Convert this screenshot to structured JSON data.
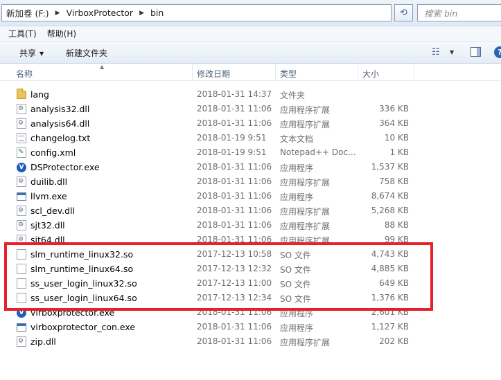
{
  "address_bar": {
    "crumbs": [
      "新加卷 (F:)",
      "VirboxProtector",
      "bin"
    ],
    "search_placeholder": "搜索 bin"
  },
  "menu": {
    "items": [
      "工具(T)",
      "帮助(H)"
    ]
  },
  "toolbar": {
    "share_label": "共享",
    "new_folder_label": "新建文件夹"
  },
  "columns": {
    "name": "名称",
    "date": "修改日期",
    "type": "类型",
    "size": "大小"
  },
  "files": [
    {
      "name": "lang",
      "date": "2018-01-31 14:37",
      "type": "文件夹",
      "size": "",
      "icon": "folder-icon"
    },
    {
      "name": "analysis32.dll",
      "date": "2018-01-31 11:06",
      "type": "应用程序扩展",
      "size": "336 KB",
      "icon": "dll-icon"
    },
    {
      "name": "analysis64.dll",
      "date": "2018-01-31 11:06",
      "type": "应用程序扩展",
      "size": "364 KB",
      "icon": "dll-icon"
    },
    {
      "name": "changelog.txt",
      "date": "2018-01-19 9:51",
      "type": "文本文档",
      "size": "10 KB",
      "icon": "txt-icon"
    },
    {
      "name": "config.xml",
      "date": "2018-01-19 9:51",
      "type": "Notepad++ Doc...",
      "size": "1 KB",
      "icon": "xml-icon"
    },
    {
      "name": "DSProtector.exe",
      "date": "2018-01-31 11:06",
      "type": "应用程序",
      "size": "1,537 KB",
      "icon": "virbox-exe-icon"
    },
    {
      "name": "duilib.dll",
      "date": "2018-01-31 11:06",
      "type": "应用程序扩展",
      "size": "758 KB",
      "icon": "dll-icon"
    },
    {
      "name": "llvm.exe",
      "date": "2018-01-31 11:06",
      "type": "应用程序",
      "size": "8,674 KB",
      "icon": "window-exe-icon"
    },
    {
      "name": "scl_dev.dll",
      "date": "2018-01-31 11:06",
      "type": "应用程序扩展",
      "size": "5,268 KB",
      "icon": "dll-icon"
    },
    {
      "name": "sjt32.dll",
      "date": "2018-01-31 11:06",
      "type": "应用程序扩展",
      "size": "88 KB",
      "icon": "dll-icon"
    },
    {
      "name": "sjt64.dll",
      "date": "2018-01-31 11:06",
      "type": "应用程序扩展",
      "size": "99 KB",
      "icon": "dll-icon"
    },
    {
      "name": "slm_runtime_linux32.so",
      "date": "2017-12-13 10:58",
      "type": "SO 文件",
      "size": "4,743 KB",
      "icon": "file-icon"
    },
    {
      "name": "slm_runtime_linux64.so",
      "date": "2017-12-13 12:32",
      "type": "SO 文件",
      "size": "4,885 KB",
      "icon": "file-icon"
    },
    {
      "name": "ss_user_login_linux32.so",
      "date": "2017-12-13 11:00",
      "type": "SO 文件",
      "size": "649 KB",
      "icon": "file-icon"
    },
    {
      "name": "ss_user_login_linux64.so",
      "date": "2017-12-13 12:34",
      "type": "SO 文件",
      "size": "1,376 KB",
      "icon": "file-icon"
    },
    {
      "name": "virboxprotector.exe",
      "date": "2018-01-31 11:06",
      "type": "应用程序",
      "size": "2,601 KB",
      "icon": "virbox-exe-icon"
    },
    {
      "name": "virboxprotector_con.exe",
      "date": "2018-01-31 11:06",
      "type": "应用程序",
      "size": "1,127 KB",
      "icon": "window-exe-icon"
    },
    {
      "name": "zip.dll",
      "date": "2018-01-31 11:06",
      "type": "应用程序扩展",
      "size": "202 KB",
      "icon": "dll-icon"
    }
  ],
  "colors": {
    "highlight_border": "#e8202a",
    "secondary_text": "#6d6d6d"
  }
}
